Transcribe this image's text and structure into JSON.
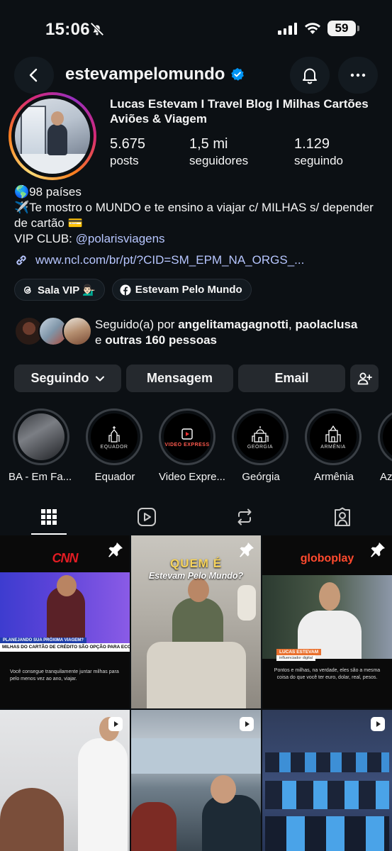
{
  "status_bar": {
    "time": "15:06",
    "battery": "59"
  },
  "header": {
    "username": "estevampelomundo"
  },
  "profile": {
    "full_name": "Lucas Estevam I Travel Blog I Milhas Cartões Aviões & Viagem",
    "stats": [
      {
        "value": "5.675",
        "label": "posts"
      },
      {
        "value": "1,5 mi",
        "label": "seguidores"
      },
      {
        "value": "1.129",
        "label": "seguindo"
      }
    ],
    "bio_line1": "🌎98 países",
    "bio_line2": "✈️Te mostro o MUNDO e te ensino a viajar c/ MILHAS s/ depender de cartão 💳",
    "bio_vip_prefix": "VIP CLUB: ",
    "bio_vip_mention": "@polarisviagens",
    "link": "www.ncl.com/br/pt/?CID=SM_EPM_NA_ORGS_..."
  },
  "chips": [
    {
      "label": "Sala VIP 💁🏻‍♂️",
      "icon": "threads-icon"
    },
    {
      "label": "Estevam Pelo Mundo",
      "icon": "facebook-icon"
    }
  ],
  "followed_by": {
    "prefix": "Seguido(a) por ",
    "user1": "angelitamagagnotti",
    "sep": ", ",
    "user2": "paolaclusa",
    "mid": " e ",
    "others": "outras 160 pessoas"
  },
  "actions": {
    "following": "Seguindo",
    "message": "Mensagem",
    "email": "Email"
  },
  "highlights": [
    {
      "name": "BA - Em Fa...",
      "sub": ""
    },
    {
      "name": "Equador",
      "sub": "EQUADOR"
    },
    {
      "name": "Video Expre...",
      "sub": "VIDEO EXPRESS"
    },
    {
      "name": "Geórgia",
      "sub": "GEÓRGIA"
    },
    {
      "name": "Armênia",
      "sub": "ARMÊNIA"
    },
    {
      "name": "Az",
      "sub": ""
    }
  ],
  "posts": {
    "p1": {
      "brand": "CNN",
      "banner1": "PLANEJANDO SUA PRÓXIMA VIAGEM?",
      "banner2": "MILHAS DO CARTÃO DE CRÉDITO SÃO OPÇÃO PARA ECONOMIZAR",
      "caption": "Você consegue tranquilamente juntar milhas para pelo menos vez ao ano, viajar."
    },
    "p2": {
      "title1": "QUEM É",
      "title2": "Estevam Pelo Mundo?"
    },
    "p3": {
      "brand": "globoplay",
      "lower_third": "LUCAS ESTEVAM",
      "lower_sub": "influenciador digital",
      "caption": "Pontos e milhas, na verdade, eles são a mesma coisa do que você ter euro, dolar, real, pesos."
    }
  },
  "colors": {
    "background": "#0c1014",
    "link": "#b7c6ff",
    "button": "#25292e",
    "verified": "#0095f6"
  }
}
